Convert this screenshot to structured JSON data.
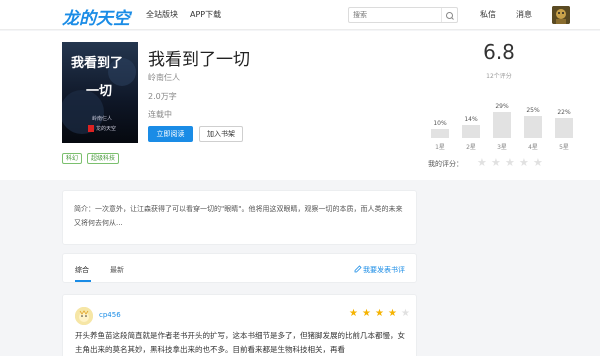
{
  "header": {
    "logo": "龙的天空",
    "nav": [
      "全站版块",
      "APP下载"
    ],
    "search_placeholder": "搜索",
    "messages": "私信",
    "notifications": "消息"
  },
  "book": {
    "cover_title_line1": "我看到了",
    "cover_title_line2": "一切",
    "cover_author": "岭南仨人",
    "cover_publisher": "龙的天空",
    "title": "我看到了一切",
    "author": "岭南仨人",
    "word_count": "2.0万字",
    "status": "连载中",
    "read_button": "立即阅读",
    "shelf_button": "加入书架",
    "tags": [
      "科幻",
      "超级科技"
    ]
  },
  "rating": {
    "score": "6.8",
    "count": "12个评分",
    "distribution": [
      {
        "label": "1星",
        "percent": 10,
        "percent_text": "10%"
      },
      {
        "label": "2星",
        "percent": 14,
        "percent_text": "14%"
      },
      {
        "label": "3星",
        "percent": 29,
        "percent_text": "29%"
      },
      {
        "label": "4星",
        "percent": 25,
        "percent_text": "25%"
      },
      {
        "label": "5星",
        "percent": 22,
        "percent_text": "22%"
      }
    ],
    "my_rating_label": "我的评分：",
    "my_rating_stars": 0
  },
  "intro": {
    "text": "简介：一次意外，让江森获得了可以看穿一切的\"眼睛\"。他将用这双眼睛，观察一切的本质，而人类的未来又将何去何从..."
  },
  "reviews_tabs": {
    "tabs": [
      "综合",
      "最新"
    ],
    "active": 0,
    "post_link": "我要发表书评"
  },
  "review": {
    "username": "cp456",
    "stars": 4,
    "max_stars": 5,
    "text": "开头养鱼苗这段简直就是作者老书开头的扩写，这本书细节是多了，但猪脚发展的比前几本都慢，女主角出来的莫名其妙，黑科技拿出来的也不多。目前看来都是生物科技相关，再看"
  }
}
